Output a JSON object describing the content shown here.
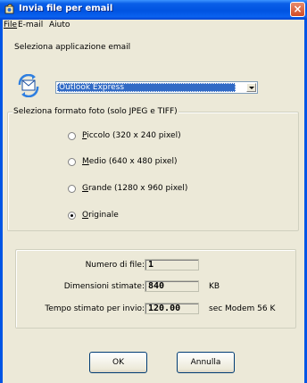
{
  "window": {
    "title": "Invia file per email",
    "close_label": "×"
  },
  "menu": {
    "file": "File",
    "email": "E-mail",
    "help": "Aiuto"
  },
  "email_app": {
    "heading": "Seleziona applicazione email",
    "selected": "Outlook Express"
  },
  "format": {
    "group_title": "Seleziona formato foto (solo JPEG e TIFF)",
    "options": [
      {
        "key": "P",
        "rest": "iccolo (320 x 240 pixel)",
        "checked": false
      },
      {
        "key": "M",
        "rest": "edio (640 x 480 pixel)",
        "checked": false
      },
      {
        "key": "G",
        "rest": "rande (1280 x 960 pixel)",
        "checked": false
      },
      {
        "key": "O",
        "rest": "riginale",
        "checked": true
      }
    ]
  },
  "stats": {
    "file_count_label": "Numero di file:",
    "file_count": "1",
    "size_label": "Dimensioni stimate:",
    "size": "840",
    "size_unit": "KB",
    "time_label": "Tempo stimato per invio:",
    "time": "120.00",
    "time_unit": "sec Modem 56 K"
  },
  "buttons": {
    "ok": "OK",
    "cancel": "Annulla"
  },
  "colors": {
    "titlebar": "#0053e1",
    "selection": "#316ac5",
    "dialog_bg": "#ece9d8"
  }
}
